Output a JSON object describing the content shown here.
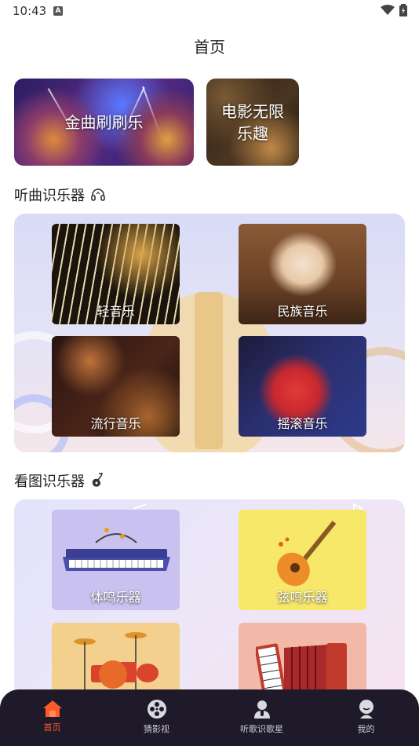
{
  "status": {
    "time": "10:43",
    "notification": "A"
  },
  "header": {
    "title": "首页"
  },
  "banners": [
    {
      "label": "金曲刷刷乐"
    },
    {
      "label_line1": "电影无限",
      "label_line2": "乐趣"
    }
  ],
  "listen_section": {
    "title": "听曲识乐器",
    "icon": "headphones-icon",
    "cards": [
      {
        "label": "轻音乐"
      },
      {
        "label": "民族音乐"
      },
      {
        "label": "流行音乐"
      },
      {
        "label": "摇滚音乐"
      }
    ]
  },
  "see_section": {
    "title": "看图识乐器",
    "icon": "guitar-icon",
    "cards": [
      {
        "label": "体鸣乐器"
      },
      {
        "label": "弦鸣乐器"
      },
      {
        "label": ""
      },
      {
        "label": ""
      }
    ]
  },
  "tabbar": {
    "items": [
      {
        "label": "首页",
        "icon": "home-icon",
        "active": true
      },
      {
        "label": "猜影视",
        "icon": "film-reel-icon",
        "active": false
      },
      {
        "label": "听歌识歌星",
        "icon": "singer-icon",
        "active": false
      },
      {
        "label": "我的",
        "icon": "profile-icon",
        "active": false
      }
    ],
    "active_color": "#ff5a2a"
  }
}
